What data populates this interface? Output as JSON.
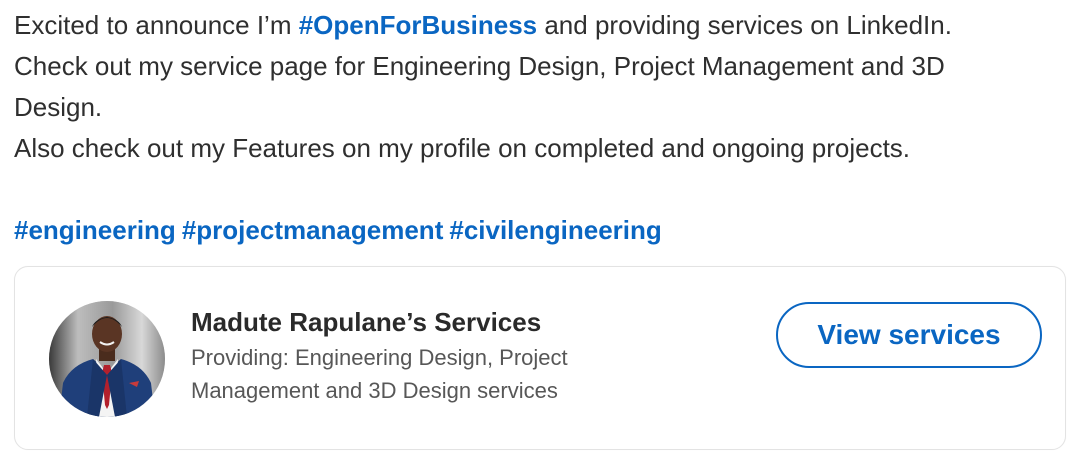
{
  "post": {
    "line1": {
      "before": "Excited to announce I’m ",
      "hashtag": "#OpenForBusiness",
      "after": " and providing services on LinkedIn."
    },
    "line2": "Check out my service page for Engineering Design, Project Management and 3D",
    "line3": "Design.",
    "line4": "Also check out my Features on my profile on completed and ongoing projects.",
    "hashtags": [
      "#engineering",
      "#projectmanagement",
      "#civilengineering"
    ]
  },
  "service_card": {
    "title": "Madute Rapulane’s Services",
    "description_line1": "Providing: Engineering Design, Project",
    "description_line2": "Management and 3D Design services",
    "button_label": "View services",
    "avatar_icon": "profile-photo"
  },
  "colors": {
    "link": "#0a66c2",
    "text": "#2f2f2f",
    "muted": "#575757",
    "card_border": "#e3e3e3"
  }
}
